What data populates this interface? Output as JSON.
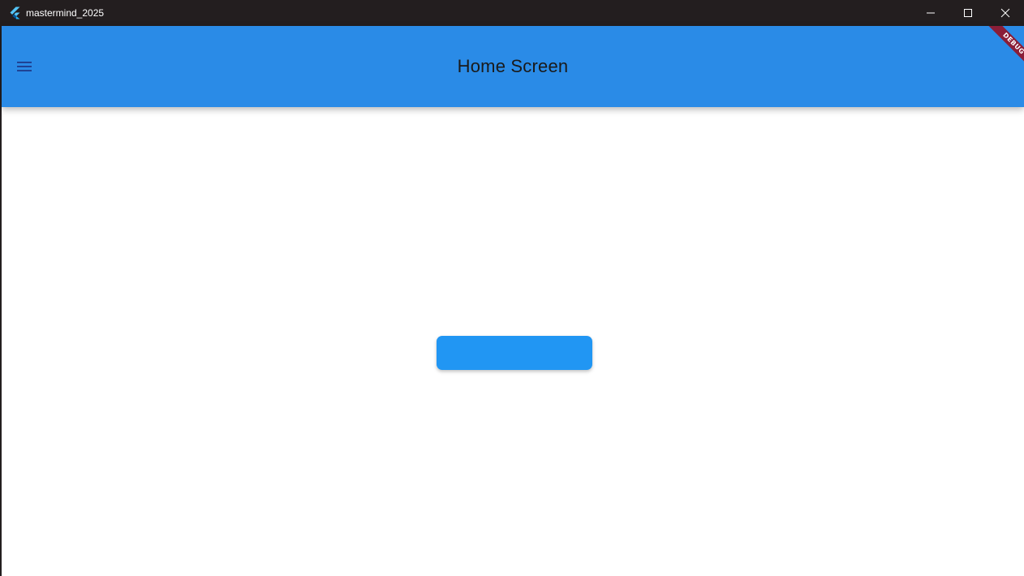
{
  "window": {
    "title": "mastermind_2025",
    "icon": "flutter-logo-icon",
    "controls": [
      "minimize-icon",
      "maximize-icon",
      "close-icon"
    ]
  },
  "appbar": {
    "title": "Home Screen",
    "menu_icon": "hamburger-menu-icon",
    "background_color": "#2a8be7"
  },
  "debug_banner": {
    "label": "DEBUG",
    "color": "#8a1e38"
  },
  "main": {
    "button_label": "",
    "button_color": "#2196f3"
  }
}
